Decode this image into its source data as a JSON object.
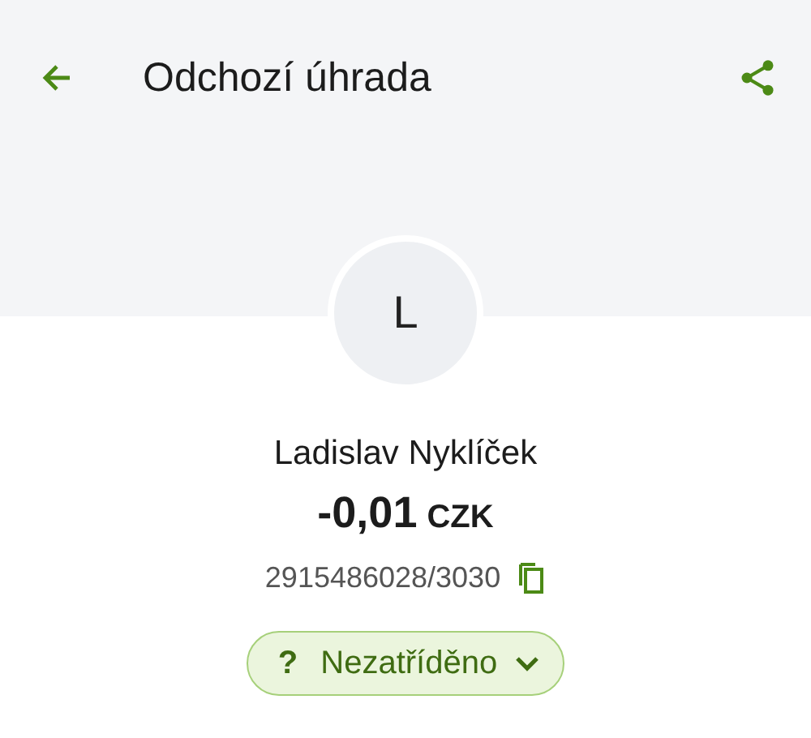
{
  "toolbar": {
    "title": "Odchozí úhrada"
  },
  "avatar": {
    "initial": "L"
  },
  "payment": {
    "name": "Ladislav Nyklíček",
    "amount": "-0,01",
    "currency": "CZK",
    "account": "2915486028/3030"
  },
  "category": {
    "icon": "?",
    "label": "Nezatříděno"
  }
}
